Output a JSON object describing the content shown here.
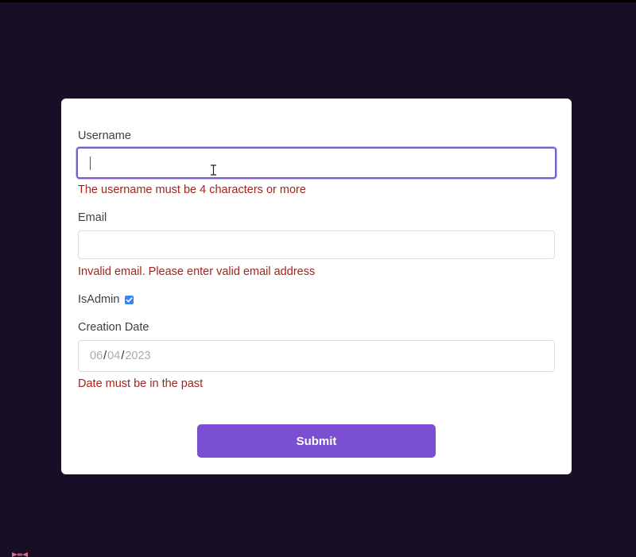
{
  "form": {
    "username": {
      "label": "Username",
      "value": "",
      "error": "The username must be 4 characters or more"
    },
    "email": {
      "label": "Email",
      "value": "",
      "error": "Invalid email. Please enter valid email address"
    },
    "is_admin": {
      "label": "IsAdmin",
      "checked": true
    },
    "creation_date": {
      "label": "Creation Date",
      "month": "06",
      "day": "04",
      "year": "2023",
      "separator": "/",
      "error": "Date must be in the past"
    },
    "submit_label": "Submit"
  },
  "colors": {
    "background": "#170f26",
    "card": "#ffffff",
    "accent": "#7a4fd1",
    "focus_border": "#7a5ccf",
    "error_text": "#a1261e",
    "checkbox": "#3b82f6"
  },
  "icons": {
    "cursor": "text-cursor-icon",
    "checkbox": "checkmark-icon",
    "corner": "ribbon-icon"
  }
}
